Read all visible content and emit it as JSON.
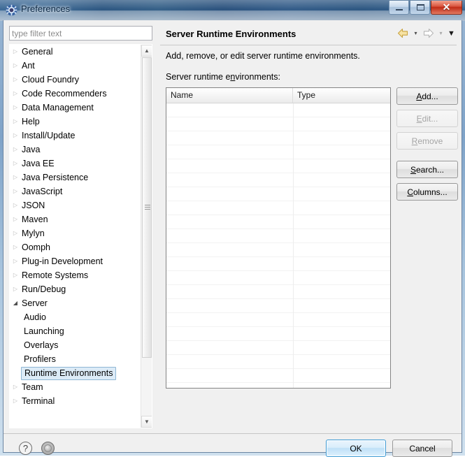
{
  "window": {
    "title": "Preferences",
    "icon": "preferences-gear-icon",
    "controls": {
      "minimize": "minimize-icon",
      "maximize": "maximize-icon",
      "close": "✕"
    }
  },
  "filter": {
    "placeholder": "type filter text",
    "value": ""
  },
  "tree": {
    "items": [
      {
        "label": "General",
        "level": 0,
        "state": "collapsed"
      },
      {
        "label": "Ant",
        "level": 0,
        "state": "collapsed"
      },
      {
        "label": "Cloud Foundry",
        "level": 0,
        "state": "collapsed"
      },
      {
        "label": "Code Recommenders",
        "level": 0,
        "state": "collapsed"
      },
      {
        "label": "Data Management",
        "level": 0,
        "state": "collapsed"
      },
      {
        "label": "Help",
        "level": 0,
        "state": "collapsed"
      },
      {
        "label": "Install/Update",
        "level": 0,
        "state": "collapsed"
      },
      {
        "label": "Java",
        "level": 0,
        "state": "collapsed"
      },
      {
        "label": "Java EE",
        "level": 0,
        "state": "collapsed"
      },
      {
        "label": "Java Persistence",
        "level": 0,
        "state": "collapsed"
      },
      {
        "label": "JavaScript",
        "level": 0,
        "state": "collapsed"
      },
      {
        "label": "JSON",
        "level": 0,
        "state": "collapsed"
      },
      {
        "label": "Maven",
        "level": 0,
        "state": "collapsed"
      },
      {
        "label": "Mylyn",
        "level": 0,
        "state": "collapsed"
      },
      {
        "label": "Oomph",
        "level": 0,
        "state": "collapsed"
      },
      {
        "label": "Plug-in Development",
        "level": 0,
        "state": "collapsed"
      },
      {
        "label": "Remote Systems",
        "level": 0,
        "state": "collapsed"
      },
      {
        "label": "Run/Debug",
        "level": 0,
        "state": "collapsed"
      },
      {
        "label": "Server",
        "level": 0,
        "state": "expanded"
      },
      {
        "label": "Audio",
        "level": 1,
        "state": "leaf"
      },
      {
        "label": "Launching",
        "level": 1,
        "state": "leaf"
      },
      {
        "label": "Overlays",
        "level": 1,
        "state": "leaf"
      },
      {
        "label": "Profilers",
        "level": 1,
        "state": "leaf"
      },
      {
        "label": "Runtime Environments",
        "level": 1,
        "state": "leaf",
        "selected": true
      },
      {
        "label": "Team",
        "level": 0,
        "state": "collapsed"
      },
      {
        "label": "Terminal",
        "level": 0,
        "state": "collapsed"
      }
    ],
    "collapsed_glyph": "▷",
    "expanded_glyph": "◢",
    "scrollbar": {
      "up_arrow": "▲",
      "down_arrow": "▼"
    }
  },
  "page": {
    "title": "Server Runtime Environments",
    "description": "Add, remove, or edit server runtime environments.",
    "list_label_pre": "Server runtime e",
    "list_label_mnemonic": "n",
    "list_label_post": "vironments:",
    "nav": {
      "back_icon": "back-arrow-icon",
      "back_dropdown": "▾",
      "forward_icon": "forward-arrow-icon",
      "forward_dropdown": "▾",
      "menu_dropdown": "▼"
    }
  },
  "table": {
    "columns": [
      "Name",
      "Type"
    ],
    "rows": [],
    "empty": true
  },
  "buttons": [
    {
      "pre": "",
      "mnemonic": "A",
      "post": "dd...",
      "label": "Add...",
      "enabled": true,
      "name": "add-button"
    },
    {
      "pre": "",
      "mnemonic": "E",
      "post": "dit...",
      "label": "Edit...",
      "enabled": false,
      "name": "edit-button"
    },
    {
      "pre": "",
      "mnemonic": "R",
      "post": "emove",
      "label": "Remove",
      "enabled": false,
      "name": "remove-button"
    },
    {
      "pre": "",
      "mnemonic": "S",
      "post": "earch...",
      "label": "Search...",
      "enabled": true,
      "name": "search-button"
    },
    {
      "pre": "",
      "mnemonic": "C",
      "post": "olumns...",
      "label": "Columns...",
      "enabled": true,
      "name": "columns-button"
    }
  ],
  "footer": {
    "help_icon": "?",
    "second_icon": "globe-icon",
    "ok_label": "OK",
    "cancel_label": "Cancel"
  },
  "colors": {
    "selection_bg": "#dcebf7",
    "selection_border": "#8fb6d4",
    "default_button_border": "#3c9ad4",
    "back_arrow": "#e6c86e",
    "titlebar_blue": "#1d4a78"
  }
}
